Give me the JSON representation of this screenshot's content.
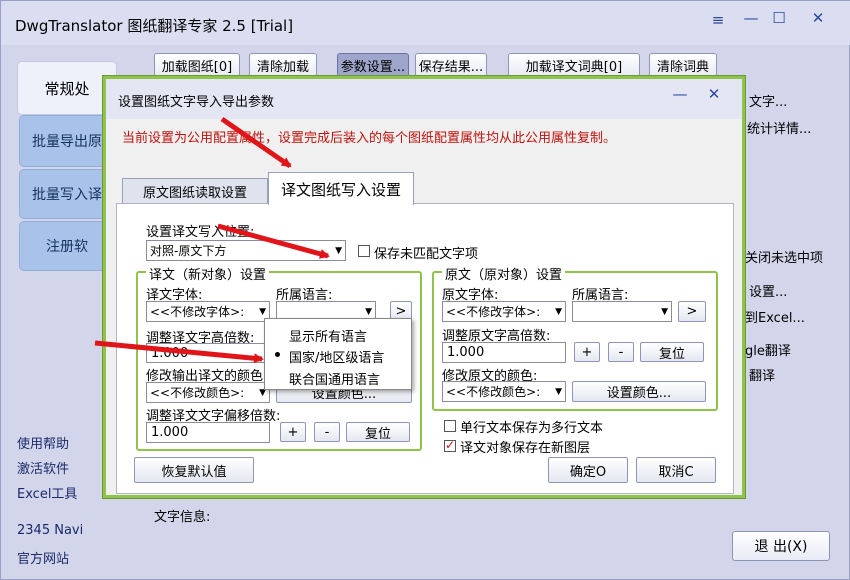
{
  "window": {
    "title": "DwgTranslator 图纸翻译专家 2.5 [Trial]",
    "controls": [
      "≡",
      "—",
      "☐",
      "✕"
    ]
  },
  "toolbar": {
    "buttons": [
      "加载图纸[0]",
      "清除加载",
      "参数设置...",
      "保存结果...",
      "加载译文词典[0]",
      "清除词典"
    ]
  },
  "sidebar": {
    "tabs": [
      "常规处",
      "批量导出原",
      "批量写入译",
      "注册软"
    ],
    "links": [
      "使用帮助",
      "激活软件",
      "Excel工具",
      "2345 Navi",
      "官方网站"
    ]
  },
  "right_panel": {
    "items": [
      "文字...",
      "统计详情...",
      "关闭未选中项",
      "设置...",
      "到Excel...",
      "gle翻译",
      "翻译"
    ]
  },
  "bottom": {
    "info_label": "文字信息:",
    "exit_button": "退 出(X)"
  },
  "dialog": {
    "title": "设置图纸文字导入导出参数",
    "controls": [
      "—",
      "✕"
    ],
    "note": "当前设置为公用配置属性，设置完成后装入的每个图纸配置属性均从此公用属性复制。",
    "tabs": [
      "原文图纸读取设置",
      "译文图纸写入设置"
    ],
    "write_pos_label": "设置译文写入位置:",
    "write_pos_value": "对照-原文下方",
    "save_unmatched": "保存未匹配文字项",
    "left_group": {
      "title": "译文（新对象）设置",
      "font_label": "译文字体:",
      "font_value": "<<不修改字体>:",
      "lang_label": "所属语言:",
      "lang_btn": ">",
      "height_label": "调整译文字高倍数:",
      "height_value": "1.000",
      "color_label": "修改输出译文的颜色:",
      "color_value": "<<不修改颜色>:",
      "color_btn": "设置颜色...",
      "offset_label": "调整译文文字偏移倍数:",
      "offset_value": "1.000",
      "plus": "+",
      "minus": "-",
      "reset": "复位"
    },
    "right_group": {
      "title": "原文（原对象）设置",
      "font_label": "原文字体:",
      "font_value": "<<不修改字体>:",
      "lang_label": "所属语言:",
      "lang_btn": ">",
      "height_label": "调整原文字高倍数:",
      "height_value": "1.000",
      "plus": "+",
      "minus": "-",
      "reset": "复位",
      "color_label": "修改原文的颜色:",
      "color_value": "<<不修改颜色>:",
      "color_btn": "设置颜色..."
    },
    "multiline": "单行文本保存为多行文本",
    "new_layer": "译文对象保存在新图层",
    "restore": "恢复默认值",
    "ok": "确定O",
    "cancel": "取消C"
  },
  "lang_menu": {
    "items": [
      "显示所有语言",
      "国家/地区级语言",
      "联合国通用语言"
    ],
    "selected_index": 1
  },
  "colors": {
    "dialog_border": "#8fc34c",
    "note_red": "#c0120c",
    "arrow_red": "#e0151a",
    "side_tab": "#a9c2ea"
  }
}
